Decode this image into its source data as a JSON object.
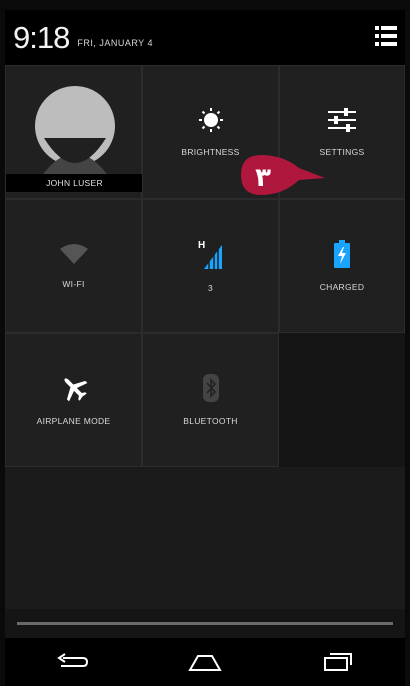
{
  "status_bar": {
    "time": "9:18",
    "date": "FRI, JANUARY 4"
  },
  "user": {
    "name": "JOHN LUSER"
  },
  "tiles": [
    {
      "label": "BRIGHTNESS",
      "icon": "brightness-icon"
    },
    {
      "label": "SETTINGS",
      "icon": "settings-sliders-icon"
    },
    {
      "label": "WI-FI",
      "icon": "wifi-icon"
    },
    {
      "label": "3",
      "icon": "signal-icon",
      "signal_type": "H"
    },
    {
      "label": "CHARGED",
      "icon": "battery-icon"
    },
    {
      "label": "AIRPLANE MODE",
      "icon": "airplane-icon"
    },
    {
      "label": "BLUETOOTH",
      "icon": "bluetooth-icon"
    }
  ],
  "callout": {
    "text": "۳",
    "color": "#b0173d"
  },
  "nav": [
    "back-icon",
    "home-icon",
    "recents-icon"
  ],
  "colors": {
    "accent": "#1aa3ff",
    "badge": "#b0173d"
  }
}
